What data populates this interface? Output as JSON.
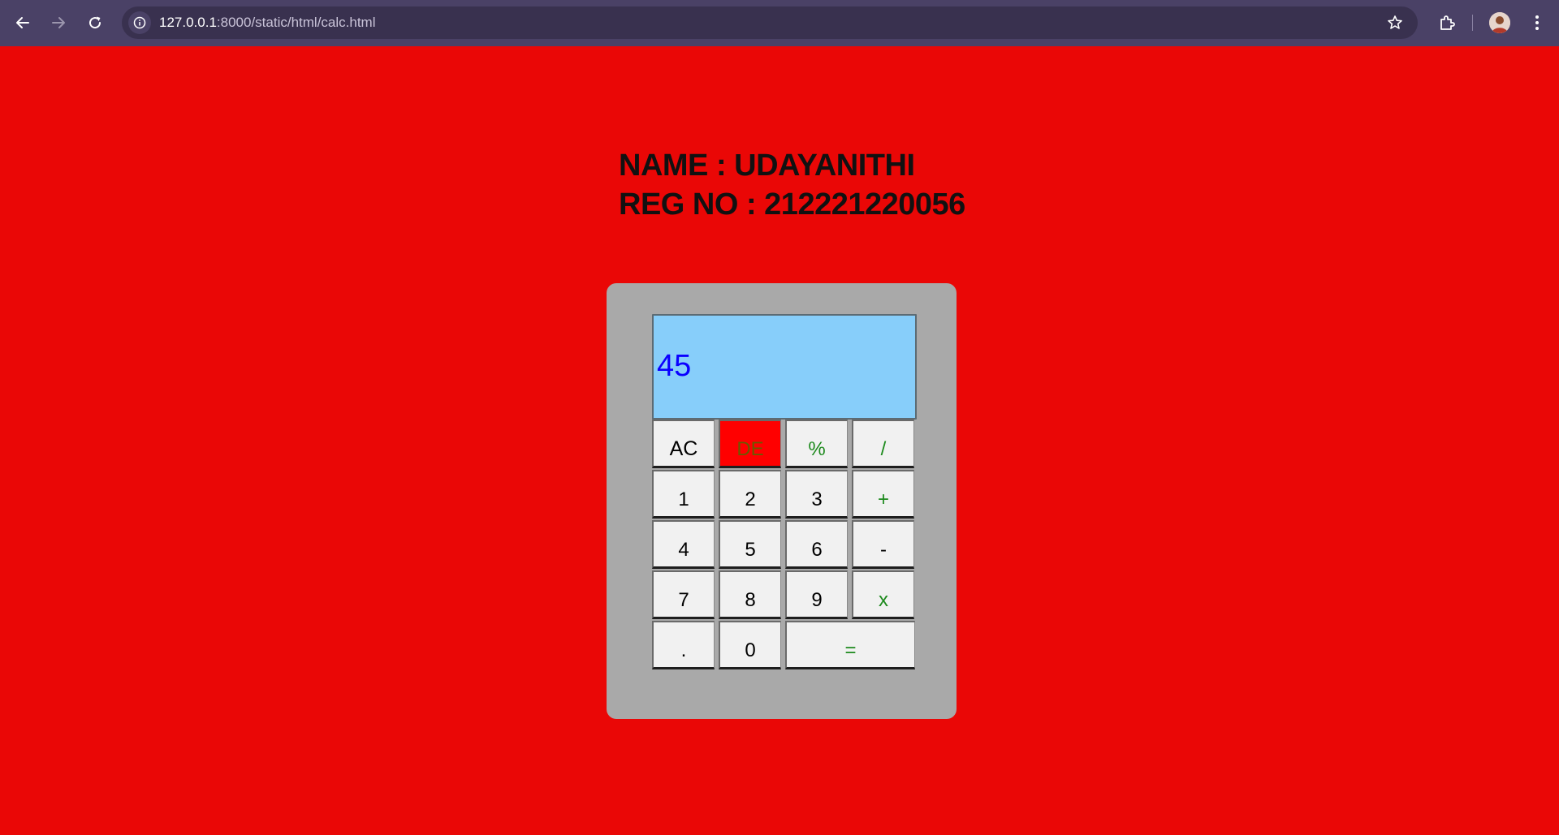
{
  "browser": {
    "url_host": "127.0.0.1",
    "url_path": ":8000/static/html/calc.html"
  },
  "heading": {
    "name_line": "NAME : UDAYANITHI",
    "reg_line": "REG NO : 212221220056"
  },
  "calculator": {
    "display_value": "45",
    "keys": [
      {
        "label": "AC",
        "type": "clear"
      },
      {
        "label": "DE",
        "type": "delete"
      },
      {
        "label": "%",
        "type": "operator"
      },
      {
        "label": "/",
        "type": "operator"
      },
      {
        "label": "1",
        "type": "digit"
      },
      {
        "label": "2",
        "type": "digit"
      },
      {
        "label": "3",
        "type": "digit"
      },
      {
        "label": "+",
        "type": "operator"
      },
      {
        "label": "4",
        "type": "digit"
      },
      {
        "label": "5",
        "type": "digit"
      },
      {
        "label": "6",
        "type": "digit"
      },
      {
        "label": "-",
        "type": "digit"
      },
      {
        "label": "7",
        "type": "digit"
      },
      {
        "label": "8",
        "type": "digit"
      },
      {
        "label": "9",
        "type": "digit"
      },
      {
        "label": "x",
        "type": "operator"
      },
      {
        "label": ".",
        "type": "digit"
      },
      {
        "label": "0",
        "type": "digit"
      },
      {
        "label": "=",
        "type": "operator"
      }
    ]
  },
  "colors": {
    "page_background": "#ea0706",
    "calculator_body": "#a9a9a9",
    "display_background": "#87cefa",
    "display_text": "#0b00ff",
    "operator_text": "#1d8a1d",
    "delete_key_background": "#ff0000"
  }
}
